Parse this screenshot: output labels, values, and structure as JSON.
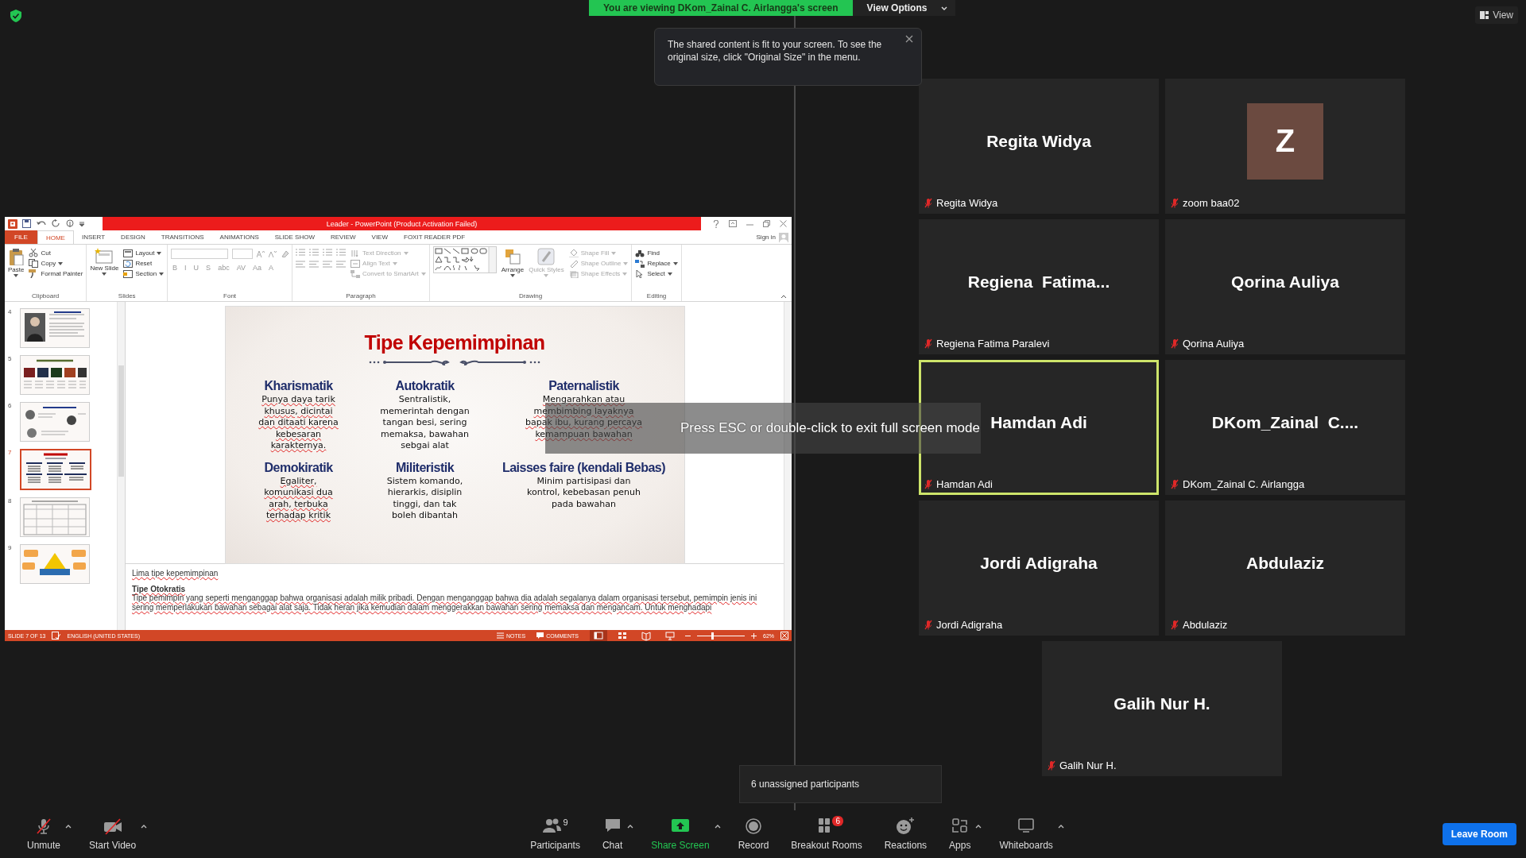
{
  "share_banner": {
    "text": "You are viewing DKom_Zainal C. Airlangga's screen",
    "options_label": "View Options"
  },
  "view_button": {
    "label": "View"
  },
  "tooltip": {
    "text": "The shared content is fit to your screen. To see the original size, click \"Original Size\" in the menu."
  },
  "fullscreen_toast": {
    "text": "Press ESC or double-click to exit full screen mode"
  },
  "powerpoint": {
    "title": "Leader -  PowerPoint (Product Activation Failed)",
    "tabs": [
      {
        "label": "FILE",
        "kind": "file",
        "selected": false
      },
      {
        "label": "HOME",
        "kind": "tab",
        "selected": true
      },
      {
        "label": "INSERT",
        "kind": "tab",
        "selected": false
      },
      {
        "label": "DESIGN",
        "kind": "tab",
        "selected": false
      },
      {
        "label": "TRANSITIONS",
        "kind": "tab",
        "selected": false
      },
      {
        "label": "ANIMATIONS",
        "kind": "tab",
        "selected": false
      },
      {
        "label": "SLIDE SHOW",
        "kind": "tab",
        "selected": false
      },
      {
        "label": "REVIEW",
        "kind": "tab",
        "selected": false
      },
      {
        "label": "VIEW",
        "kind": "tab",
        "selected": false
      },
      {
        "label": "FOXIT READER PDF",
        "kind": "tab",
        "selected": false
      }
    ],
    "sign_in": "Sign in",
    "ribbon": [
      {
        "label": "Clipboard",
        "kind": "buttons",
        "items": [
          {
            "label": "Paste",
            "kind": "large",
            "dropdown": true,
            "disabled": false
          },
          {
            "label": "Cut",
            "kind": "small",
            "dropdown": false,
            "disabled": false
          },
          {
            "label": "Copy",
            "kind": "small",
            "dropdown": true,
            "disabled": false
          },
          {
            "label": "Format Painter",
            "kind": "small",
            "dropdown": false,
            "disabled": false
          }
        ]
      },
      {
        "label": "Slides",
        "kind": "buttons",
        "items": [
          {
            "label": "New Slide",
            "kind": "large",
            "dropdown": true,
            "disabled": false
          },
          {
            "label": "Layout",
            "kind": "small",
            "dropdown": true,
            "disabled": false
          },
          {
            "label": "Reset",
            "kind": "small",
            "dropdown": false,
            "disabled": false
          },
          {
            "label": "Section",
            "kind": "small",
            "dropdown": true,
            "disabled": false
          }
        ]
      },
      {
        "label": "Font",
        "kind": "font",
        "glyphs": [
          "B",
          "I",
          "U",
          "S",
          "abc",
          "AV",
          "Aa",
          "A"
        ]
      },
      {
        "label": "Paragraph",
        "kind": "paragraph",
        "items": [
          {
            "label": "Text Direction",
            "kind": "small",
            "dropdown": true,
            "disabled": true
          },
          {
            "label": "Align Text",
            "kind": "small",
            "dropdown": true,
            "disabled": true
          },
          {
            "label": "Convert to SmartArt",
            "kind": "small",
            "dropdown": true,
            "disabled": true
          }
        ]
      },
      {
        "label": "Drawing",
        "kind": "drawing",
        "items": [
          {
            "label": "Arrange",
            "kind": "large",
            "dropdown": true,
            "disabled": false
          },
          {
            "label": "Quick Styles",
            "kind": "large",
            "dropdown": true,
            "disabled": true
          },
          {
            "label": "Shape Fill",
            "kind": "small",
            "dropdown": true,
            "disabled": true
          },
          {
            "label": "Shape Outline",
            "kind": "small",
            "dropdown": true,
            "disabled": true
          },
          {
            "label": "Shape Effects",
            "kind": "small",
            "dropdown": true,
            "disabled": true
          }
        ]
      },
      {
        "label": "Editing",
        "kind": "buttons",
        "items": [
          {
            "label": "Find",
            "kind": "small",
            "dropdown": false,
            "disabled": false
          },
          {
            "label": "Replace",
            "kind": "small",
            "dropdown": true,
            "disabled": false
          },
          {
            "label": "Select",
            "kind": "small",
            "dropdown": true,
            "disabled": false
          }
        ]
      }
    ],
    "thumbnails": [
      {
        "number": "4",
        "kind": "portrait",
        "selected": false
      },
      {
        "number": "5",
        "kind": "images",
        "selected": false
      },
      {
        "number": "6",
        "kind": "figures",
        "selected": false
      },
      {
        "number": "7",
        "kind": "columns",
        "selected": true
      },
      {
        "number": "8",
        "kind": "table",
        "selected": false
      },
      {
        "number": "9",
        "kind": "diagram",
        "selected": false
      }
    ],
    "slide": {
      "title": "Tipe Kepemimpinan",
      "blocks": [
        {
          "heading": "Kharismatik",
          "body": "Punya daya tarik\nkhusus, dicintai\ndan ditaati karena\nkebesaran\nkarakternya.",
          "spellcheck": true
        },
        {
          "heading": "Autokratik",
          "body": "Sentralistik,\nmemerintah dengan\ntangan besi, sering\nmemaksa, bawahan\nsebgai alat",
          "spellcheck": false
        },
        {
          "heading": "Paternalistik",
          "body": "Mengarahkan atau\nmembimbing layaknya\nbapak ibu, kurang percaya\nkemampuan bawahan",
          "spellcheck": true
        },
        {
          "heading": "Demokiratik",
          "body": "Egaliter,\nkomunikasi dua\narah, terbuka\nterhadap kritik",
          "spellcheck": true
        },
        {
          "heading": "Militeristik",
          "body": "Sistem komando,\nhierarkis, disiplin\ntinggi, dan tak\nboleh dibantah",
          "spellcheck": false
        },
        {
          "heading": "Laisses faire (kendali Bebas)",
          "body": "Minim partisipasi dan\nkontrol, kebebasan penuh\npada bawahan",
          "spellcheck": false
        }
      ]
    },
    "notes": {
      "heading": "Lima tipe kepemimpinan",
      "subheading": "Tipe Otokratis",
      "body": "Tipe pemimpin yang seperti menganggap bahwa organisasi adalah milik pribadi. Dengan menganggap bahwa dia adalah segalanya dalam organisasi tersebut, pemimpin jenis ini sering memperlakukan bawahan sebagai alat saja. Tidak heran jika kemudian dalam menggerakkan bawahan sering memaksa dan mengancam. Untuk menghadapi",
      "spellcheck": true
    },
    "status": {
      "slide": "SLIDE 7 OF 13",
      "language": "ENGLISH (UNITED STATES)",
      "notes": "NOTES",
      "comments": "COMMENTS",
      "zoom": "62%",
      "zoom_slider": {
        "level": 0.32
      }
    }
  },
  "participants": [
    {
      "name": "Regita Widya",
      "label": "Regita Widya",
      "kind": "name",
      "muted": true,
      "speaking": false
    },
    {
      "name": "Z",
      "label": "zoom baa02",
      "kind": "avatar",
      "color": "#6b4a40",
      "muted": true,
      "speaking": false
    },
    {
      "name": "Regiena  Fatima...",
      "label": "Regiena Fatima Paralevi",
      "kind": "name",
      "muted": true,
      "speaking": false
    },
    {
      "name": "Qorina Auliya",
      "label": "Qorina Auliya",
      "kind": "name",
      "muted": true,
      "speaking": false
    },
    {
      "name": "Hamdan Adi",
      "label": "Hamdan Adi",
      "kind": "name",
      "muted": true,
      "speaking": true
    },
    {
      "name": "DKom_Zainal  C....",
      "label": "DKom_Zainal C. Airlangga",
      "kind": "name",
      "muted": true,
      "speaking": false
    },
    {
      "name": "Jordi Adigraha",
      "label": "Jordi Adigraha",
      "kind": "name",
      "muted": true,
      "speaking": false
    },
    {
      "name": "Abdulaziz",
      "label": "Abdulaziz",
      "kind": "name",
      "muted": true,
      "speaking": false
    },
    {
      "name": "Galih Nur H.",
      "label": "Galih Nur H.",
      "kind": "name",
      "muted": true,
      "speaking": false
    }
  ],
  "breakout_popup": {
    "text": "6 unassigned participants"
  },
  "toolbar": {
    "items": [
      {
        "label": "Unmute",
        "kind": "mic",
        "caret": true
      },
      {
        "label": "Start Video",
        "kind": "video",
        "caret": true
      },
      {
        "label": "Participants",
        "kind": "participants",
        "count": "9",
        "caret": false
      },
      {
        "label": "Chat",
        "kind": "chat",
        "caret": true
      },
      {
        "label": "Share Screen",
        "kind": "share",
        "caret": true
      },
      {
        "label": "Record",
        "kind": "record",
        "caret": false
      },
      {
        "label": "Breakout Rooms",
        "kind": "breakout",
        "badge": "6",
        "caret": false
      },
      {
        "label": "Reactions",
        "kind": "reactions",
        "caret": false
      },
      {
        "label": "Apps",
        "kind": "apps",
        "caret": true
      },
      {
        "label": "Whiteboards",
        "kind": "whiteboard",
        "caret": true
      }
    ],
    "leave": "Leave Room"
  }
}
